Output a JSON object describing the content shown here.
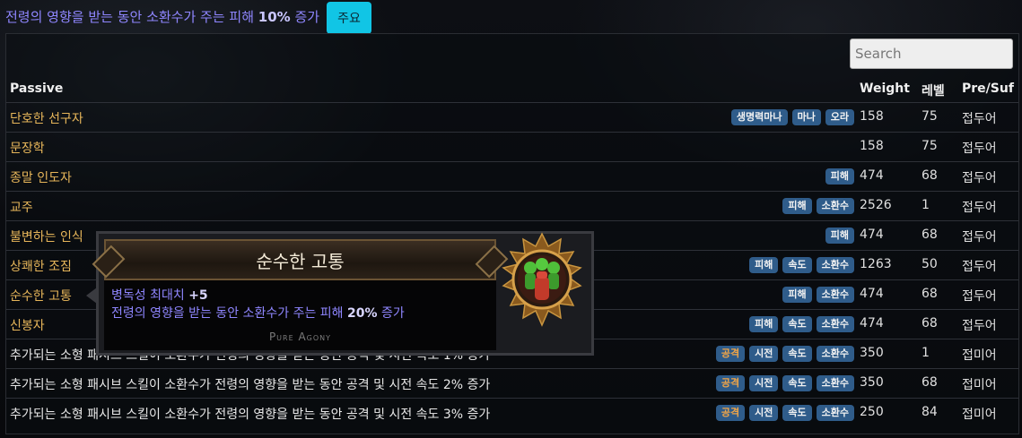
{
  "top": {
    "pre": "전령의 영향을 받는 동안 소환수가 주는 피해 ",
    "value": "10%",
    "post": " 증가",
    "button": "주요"
  },
  "search": {
    "placeholder": "Search"
  },
  "headers": {
    "passive": "Passive",
    "weight": "Weight",
    "level": "레벨",
    "presuf": "Pre/Suf"
  },
  "rows": [
    {
      "name": "단호한 선구자",
      "tags": [
        "생명력마나",
        "마나",
        "오라"
      ],
      "weight": "158",
      "level": "75",
      "presuf": "접두어"
    },
    {
      "name": "문장학",
      "tags": [],
      "weight": "158",
      "level": "75",
      "presuf": "접두어"
    },
    {
      "name": "종말 인도자",
      "tags": [
        "피해"
      ],
      "weight": "474",
      "level": "68",
      "presuf": "접두어"
    },
    {
      "name": "교주",
      "tags": [
        "피해",
        "소환수"
      ],
      "weight": "2526",
      "level": "1",
      "presuf": "접두어"
    },
    {
      "name": "불변하는 인식",
      "tags": [
        "피해"
      ],
      "weight": "474",
      "level": "68",
      "presuf": "접두어"
    },
    {
      "name": "상쾌한 조짐",
      "tags": [
        "피해",
        "속도",
        "소환수"
      ],
      "weight": "1263",
      "level": "50",
      "presuf": "접두어"
    },
    {
      "name": "순수한 고통",
      "tags": [
        "피해",
        "소환수"
      ],
      "weight": "474",
      "level": "68",
      "presuf": "접두어"
    },
    {
      "name": "신봉자",
      "tags": [
        "피해",
        "속도",
        "소환수"
      ],
      "weight": "474",
      "level": "68",
      "presuf": "접두어"
    },
    {
      "name": "추가되는 소형 패시브 스킬이 소환수가 전령의 영향을 받는 동안 공격 및 시전 속도 1% 증가",
      "tags": [
        "공격",
        "시전",
        "속도",
        "소환수"
      ],
      "weight": "350",
      "level": "1",
      "presuf": "접미어"
    },
    {
      "name": "추가되는 소형 패시브 스킬이 소환수가 전령의 영향을 받는 동안 공격 및 시전 속도 2% 증가",
      "tags": [
        "공격",
        "시전",
        "속도",
        "소환수"
      ],
      "weight": "350",
      "level": "68",
      "presuf": "접미어"
    },
    {
      "name": "추가되는 소형 패시브 스킬이 소환수가 전령의 영향을 받는 동안 공격 및 시전 속도 3% 증가",
      "tags": [
        "공격",
        "시전",
        "속도",
        "소환수"
      ],
      "weight": "250",
      "level": "84",
      "presuf": "접미어"
    }
  ],
  "tooltip": {
    "title": "순수한 고통",
    "line1_text": "병독성 최대치 ",
    "line1_value": "+5",
    "line2_pre": "전령의 영향을 받는 동안 소환수가 주는 피해 ",
    "line2_value": "20%",
    "line2_post": " 증가",
    "footer": "Pure Agony",
    "icon": "pure-agony-notable-icon"
  },
  "colors": {
    "accent": "#11c5e5",
    "tag": "#2f5c8a",
    "gold": "#e7b65a",
    "mod": "#8f86ff",
    "attack_tag_text": "#f0a548"
  }
}
